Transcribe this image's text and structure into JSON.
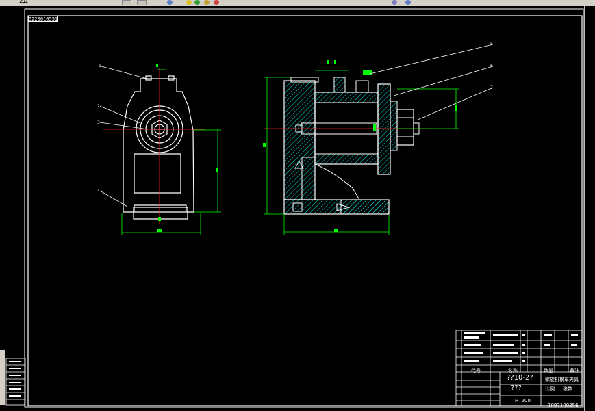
{
  "toolbar": {
    "label": "2Д"
  },
  "drawing": {
    "frame_label": "5220010551"
  },
  "title_block": {
    "drawing_number": "??10-2?",
    "subtitle": "???",
    "name": "螺旋机構车夹具",
    "scale_label": "比例",
    "sheet_label": "张数",
    "material": "HT200",
    "school": "1097100356",
    "col_code": "代号",
    "col_name": "名称",
    "col_qty": "数量",
    "col_remark": "备注"
  },
  "colors": {
    "dim": "#00ff00",
    "center": "#ff0000",
    "hatch": "#00ffff",
    "outline": "#ffffff"
  }
}
